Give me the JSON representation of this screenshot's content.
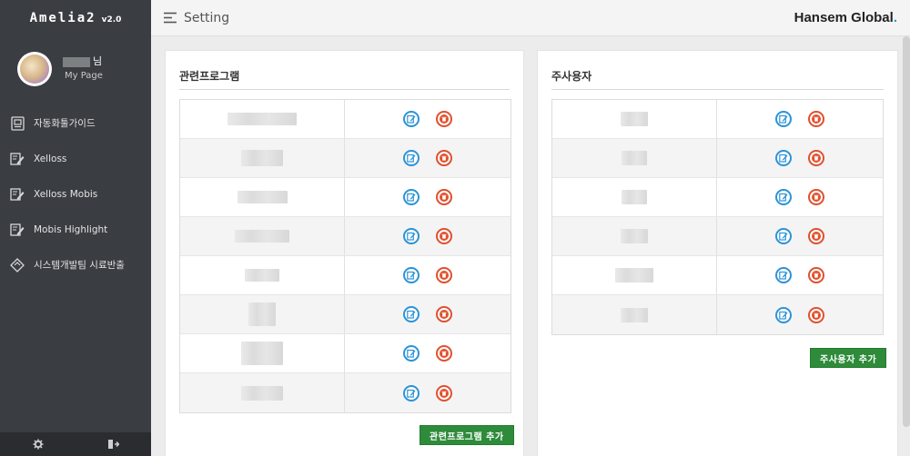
{
  "app": {
    "name": "Amelia2",
    "version": "v2.0"
  },
  "profile": {
    "name_suffix": "님",
    "mypage": "My Page"
  },
  "sidebar": {
    "items": [
      {
        "label": "자동화툴가이드",
        "icon": "guide-icon"
      },
      {
        "label": "Xelloss",
        "icon": "edit-doc-icon"
      },
      {
        "label": "Xelloss Mobis",
        "icon": "edit-doc-icon"
      },
      {
        "label": "Mobis Highlight",
        "icon": "edit-doc-icon"
      },
      {
        "label": "시스템개발팀 시료반출",
        "icon": "diamond-arrows-icon"
      }
    ],
    "footer": [
      {
        "icon": "gear-icon"
      },
      {
        "icon": "logout-icon"
      }
    ]
  },
  "header": {
    "title": "Setting",
    "logo_text": "Hansem Global",
    "logo_dot": "."
  },
  "related_programs": {
    "title": "관련프로그램",
    "rows": 8,
    "add_label": "관련프로그램 추가"
  },
  "managers": {
    "title": "주사용자",
    "rows": 6,
    "add_label": "주사용자 추가"
  },
  "colors": {
    "edit": "#2c93d6",
    "delete": "#e0502e",
    "add_button": "#2e8b3a",
    "sidebar": "#3a3d42"
  }
}
